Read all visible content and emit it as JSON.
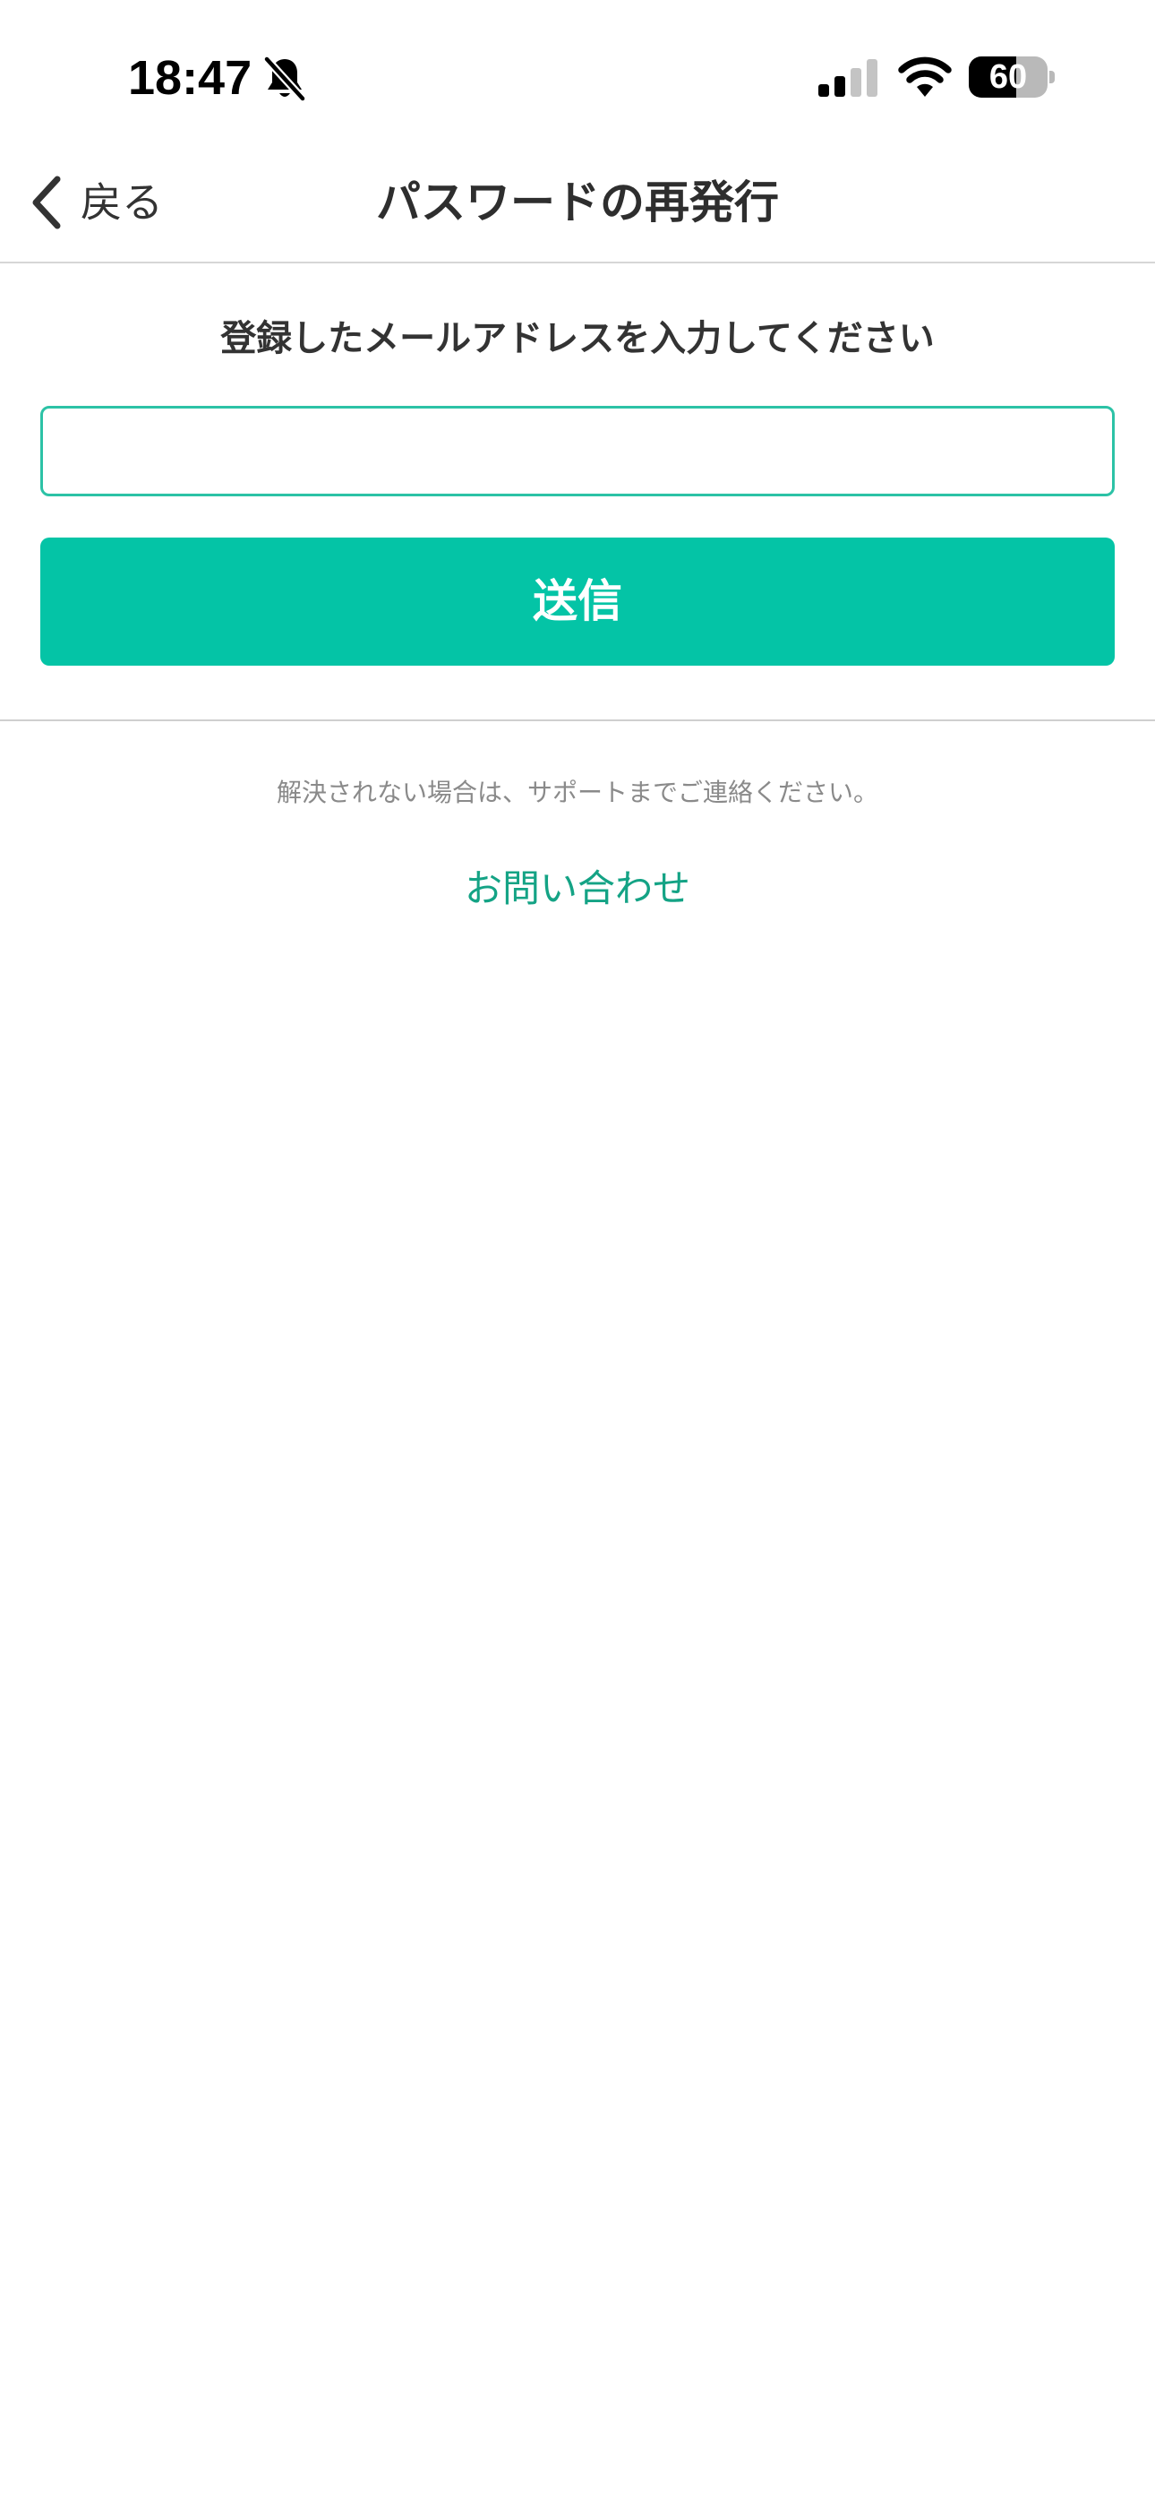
{
  "status_bar": {
    "time": "18:47",
    "battery_level": 60,
    "battery_label": "60",
    "icons": [
      "bell-slash-icon",
      "cellular-signal-icon",
      "wifi-icon",
      "battery-icon"
    ]
  },
  "nav": {
    "back_label": "戻る",
    "back_icon": "chevron-left-icon",
    "title": "パスワードの再発行"
  },
  "form": {
    "instruction": "登録したメールアドレスを入力してください",
    "email_value": "",
    "email_placeholder": "",
    "submit_label": "送信"
  },
  "support": {
    "note": "解決されない場合は、サポートまでご連絡ください。",
    "contact_label": "お問い合わせ"
  },
  "colors": {
    "accent": "#04c4a6",
    "input_border": "#2cc2a6",
    "link": "#14a385",
    "text": "#333333",
    "muted_text": "#8a8a8a"
  }
}
